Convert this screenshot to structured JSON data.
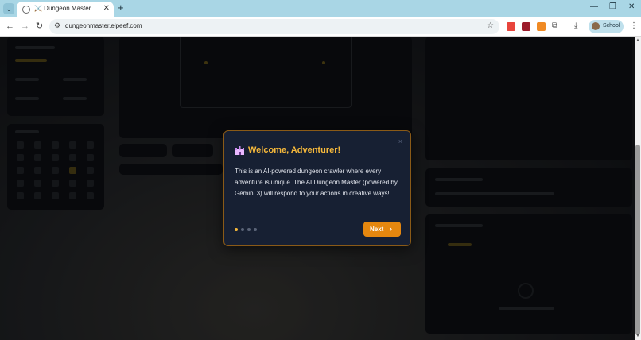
{
  "browser": {
    "tab_title": "⚔️ Dungeon Master",
    "tab_close": "✕",
    "new_tab": "+",
    "url": "dungeonmaster.elpeef.com",
    "profile_label": "School",
    "window_controls": {
      "minimize": "—",
      "restore": "❐",
      "close": "✕"
    },
    "icons": [
      "tab-search-icon",
      "back-icon",
      "forward-icon",
      "reload-icon",
      "site-info-icon",
      "bookmark-star-icon",
      "extensions-icon",
      "download-icon",
      "menu-icon"
    ]
  },
  "modal": {
    "title": "Welcome, Adventurer!",
    "body": "This is an AI-powered dungeon crawler where every adventure is unique. The AI Dungeon Master (powered by Gemini 3) will respond to your actions in creative ways!",
    "next_label": "Next",
    "close": "×",
    "steps_total": 4,
    "current_step": 1
  },
  "colors": {
    "accent_gold": "#f5b83b",
    "button_orange": "#e5870f",
    "modal_bg": "#172033",
    "modal_border": "#8a5a17",
    "browser_frame": "#a9d6e5"
  }
}
